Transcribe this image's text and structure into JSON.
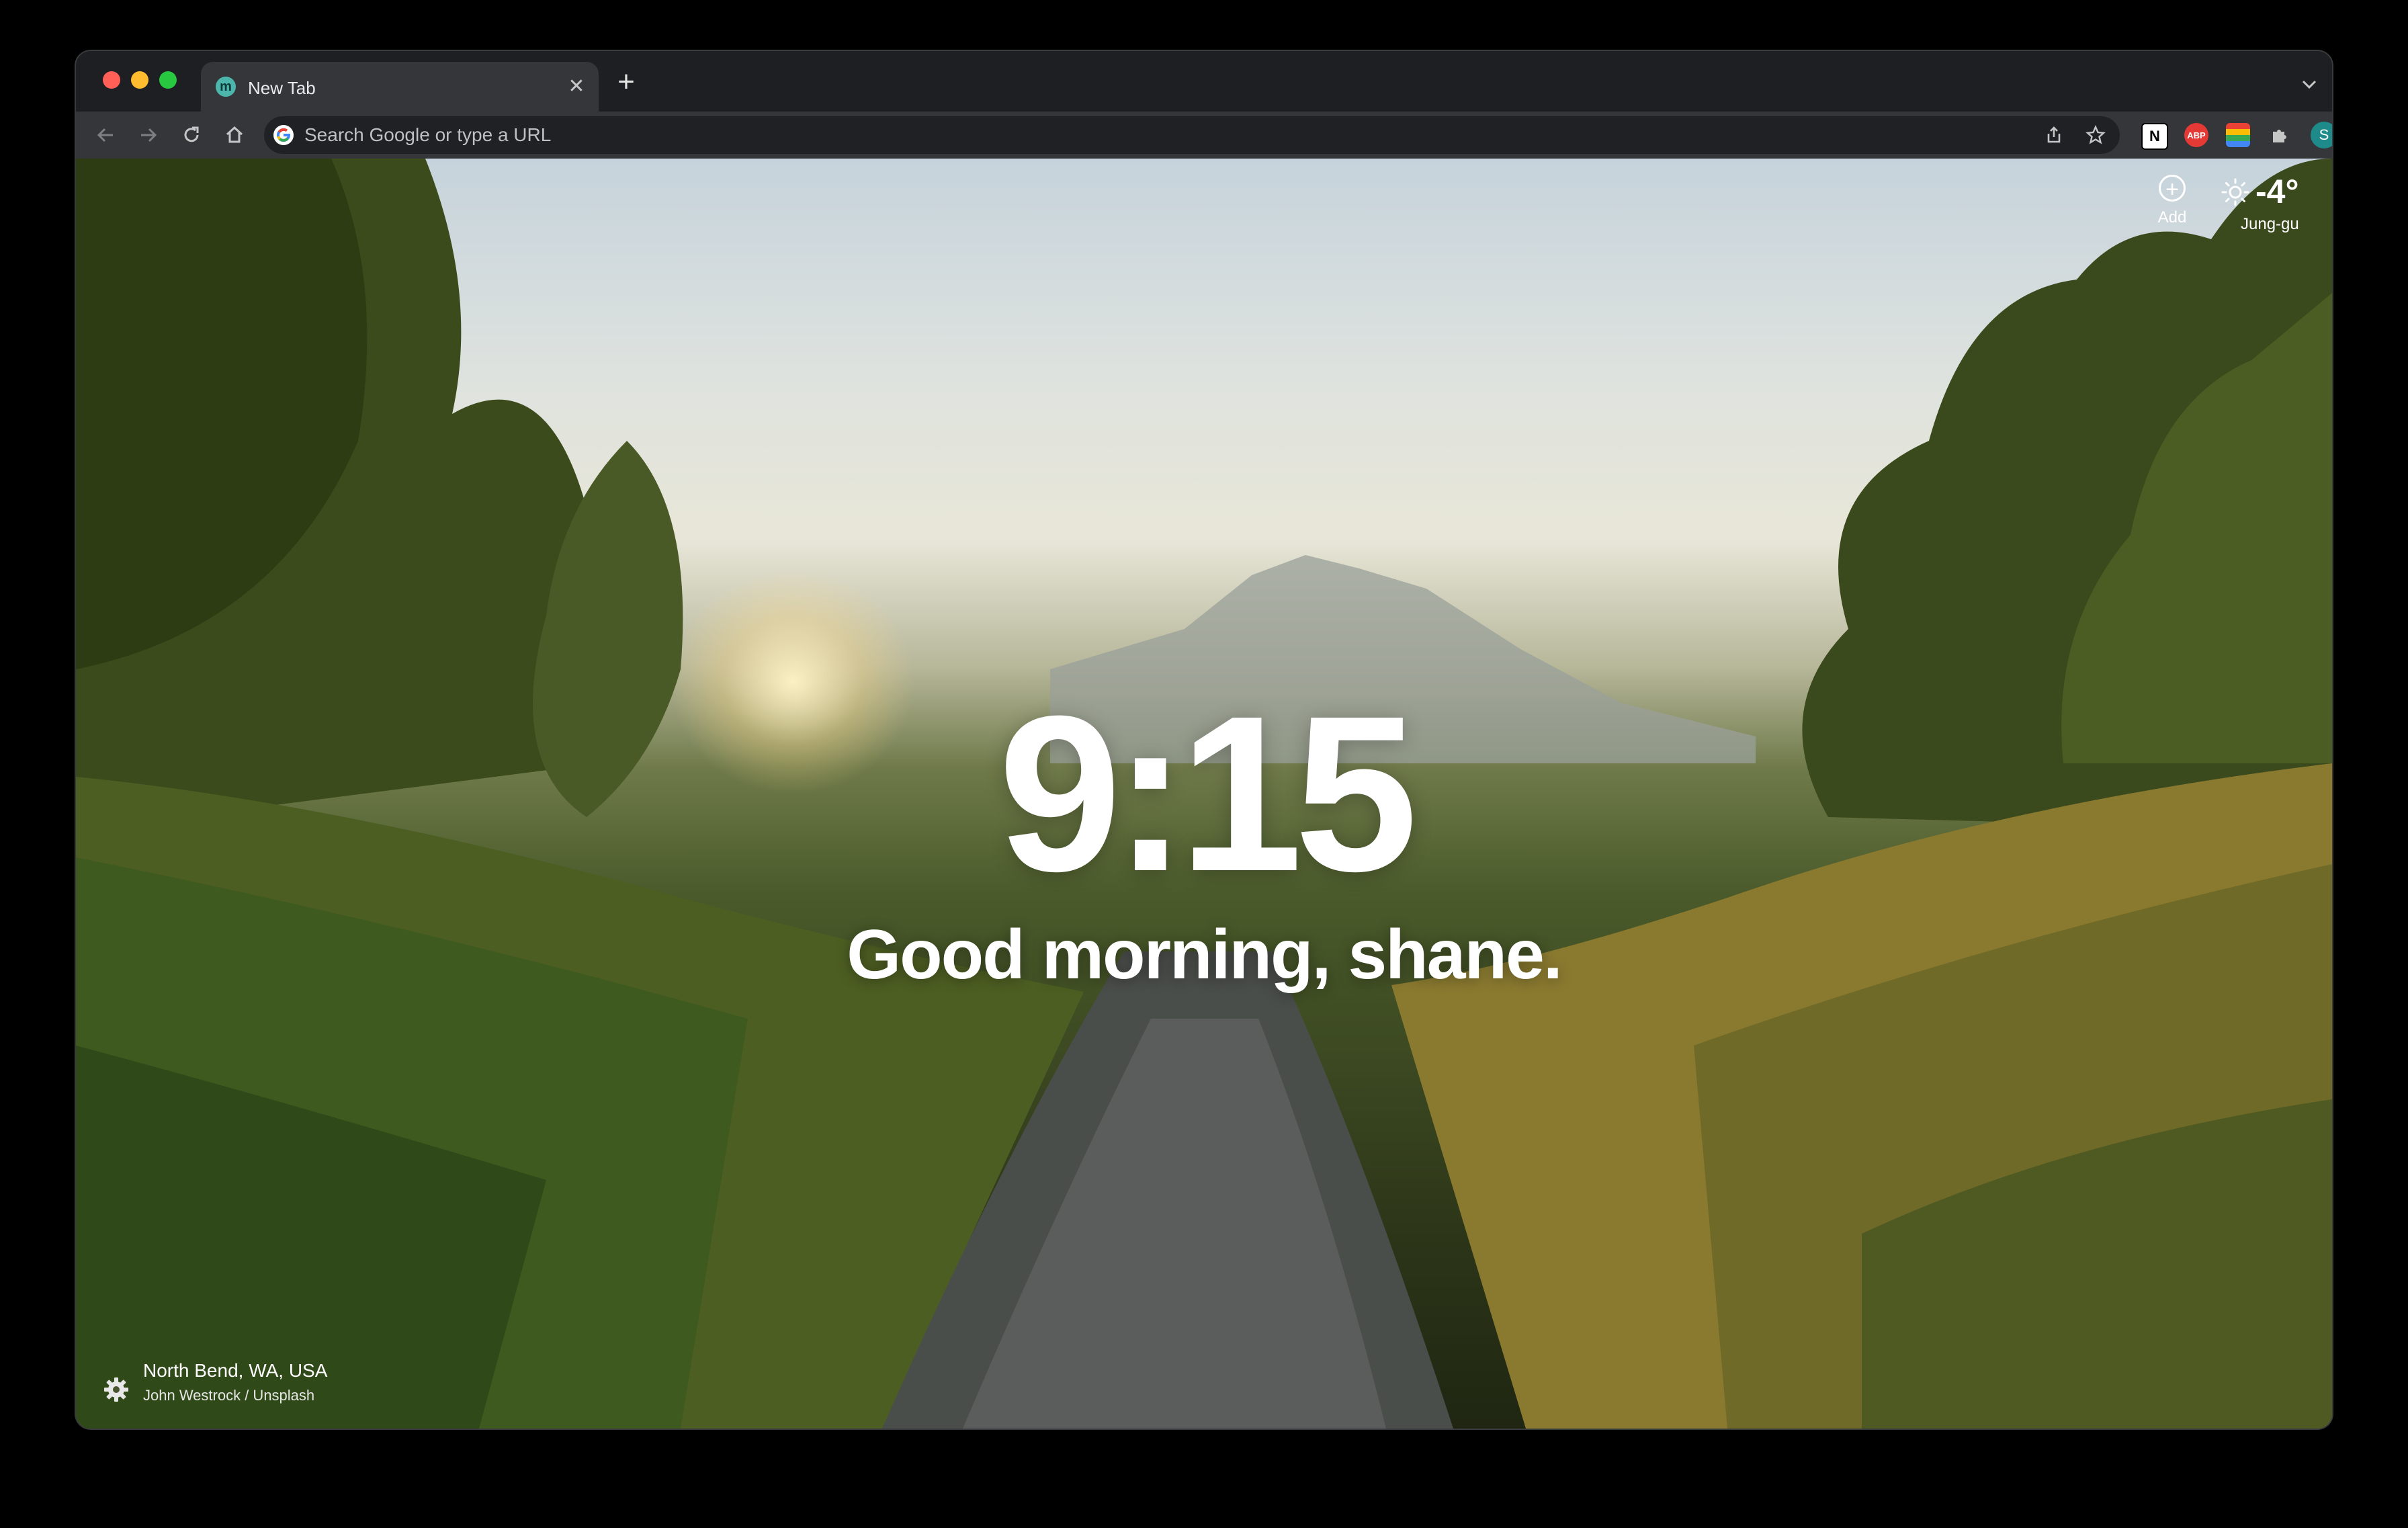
{
  "tab": {
    "title": "New Tab",
    "favicon_letter": "m"
  },
  "toolbar": {
    "omnibox_placeholder": "Search Google or type a URL",
    "extensions": [
      {
        "name": "notion",
        "label": "N"
      },
      {
        "name": "adblock-plus",
        "label": "ABP"
      },
      {
        "name": "colorful-extension",
        "label": ""
      },
      {
        "name": "extensions-puzzle",
        "label": ""
      }
    ],
    "profile_initial": "S"
  },
  "widgets": {
    "add_label": "Add",
    "temperature": "-4°",
    "location": "Jung-gu"
  },
  "main": {
    "time": "9:15",
    "greeting": "Good morning, shane."
  },
  "photo": {
    "location": "North Bend, WA, USA",
    "credit": "John Westrock / Unsplash"
  },
  "colors": {
    "accent_profile": "#1e8a8a",
    "abp_red": "#e53935"
  }
}
